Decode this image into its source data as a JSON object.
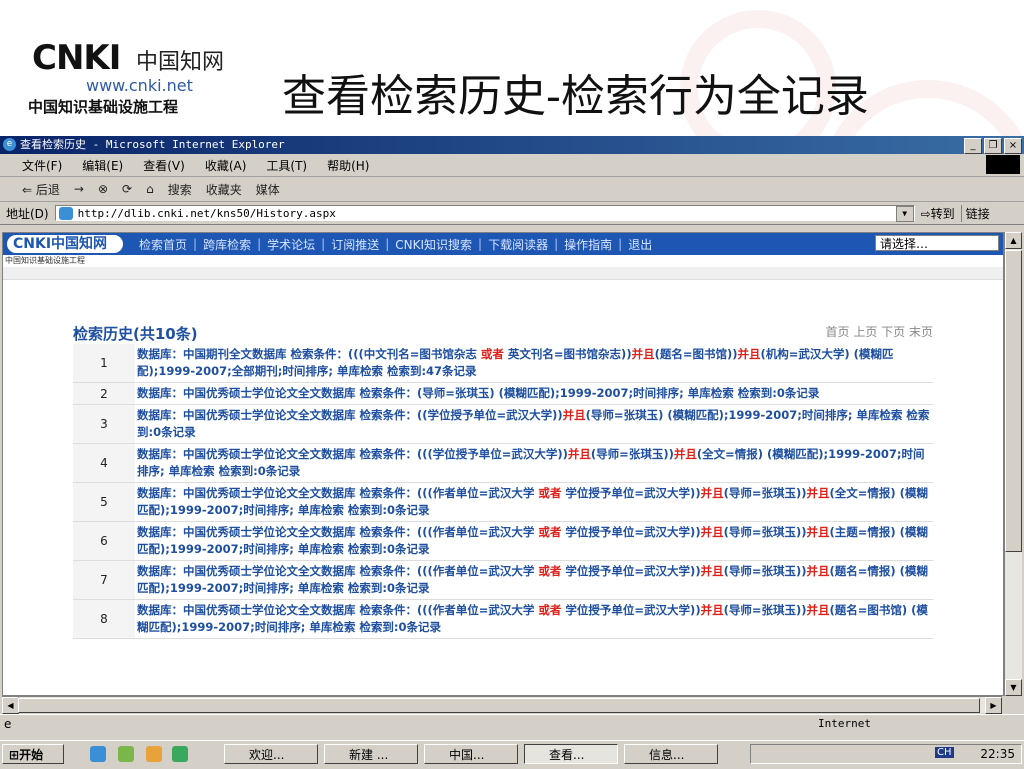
{
  "slide": {
    "logo_cnki": "CNKI",
    "logo_cn": "中国知网",
    "logo_url": "www.cnki.net",
    "logo_tagline": "中国知识基础设施工程",
    "title": "查看检索历史-检索行为全记录"
  },
  "window": {
    "title": "查看检索历史 - Microsoft Internet Explorer",
    "menu": [
      "文件(F)",
      "编辑(E)",
      "查看(V)",
      "收藏(A)",
      "工具(T)",
      "帮助(H)"
    ],
    "toolbar": [
      "⇐ 后退",
      "→",
      "⊗",
      "⟳",
      "⌂",
      "搜索",
      "收藏夹",
      "媒体"
    ],
    "address_label": "地址(D)",
    "address": "http://dlib.cnki.net/kns50/History.aspx",
    "go_label": "转到",
    "links_label": "链接",
    "status_zone": "Internet"
  },
  "site": {
    "logo": "CNKI中国知网",
    "subline": "中国知识基础设施工程",
    "nav": [
      "检索首页",
      "跨库检索",
      "学术论坛",
      "订阅推送",
      "CNKI知识搜索",
      "下载阅读器",
      "操作指南",
      "退出"
    ],
    "select": "请选择…"
  },
  "history": {
    "title": "检索历史(共10条)",
    "pager": "首页 上页 下页 末页",
    "rows": [
      {
        "num": "1",
        "parts": [
          [
            "数据库：中国期刊全文数据库  检索条件：(((中文刊名=图书馆杂志 ",
            0
          ],
          [
            "或者",
            1
          ],
          [
            " 英文刊名=图书馆杂志))",
            0
          ],
          [
            "并且",
            1
          ],
          [
            "(题名=图书馆))",
            0
          ],
          [
            "并且",
            1
          ],
          [
            "(机构=武汉大学) (模糊匹配);1999-2007;全部期刊;时间排序; 单库检索  检索到:47条记录",
            0
          ]
        ]
      },
      {
        "num": "2",
        "parts": [
          [
            "数据库：中国优秀硕士学位论文全文数据库  检索条件：(导师=张琪玉) (模糊匹配);1999-2007;时间排序; 单库检索  检索到:0条记录",
            0
          ]
        ]
      },
      {
        "num": "3",
        "parts": [
          [
            "数据库：中国优秀硕士学位论文全文数据库  检索条件：((学位授予单位=武汉大学))",
            0
          ],
          [
            "并且",
            1
          ],
          [
            "(导师=张琪玉) (模糊匹配);1999-2007;时间排序; 单库检索  检索到:0条记录",
            0
          ]
        ]
      },
      {
        "num": "4",
        "parts": [
          [
            "数据库：中国优秀硕士学位论文全文数据库  检索条件：(((学位授予单位=武汉大学))",
            0
          ],
          [
            "并且",
            1
          ],
          [
            "(导师=张琪玉))",
            0
          ],
          [
            "并且",
            1
          ],
          [
            "(全文=情报) (模糊匹配);1999-2007;时间排序; 单库检索  检索到:0条记录",
            0
          ]
        ]
      },
      {
        "num": "5",
        "parts": [
          [
            "数据库：中国优秀硕士学位论文全文数据库  检索条件：(((作者单位=武汉大学 ",
            0
          ],
          [
            "或者",
            1
          ],
          [
            " 学位授予单位=武汉大学))",
            0
          ],
          [
            "并且",
            1
          ],
          [
            "(导师=张琪玉))",
            0
          ],
          [
            "并且",
            1
          ],
          [
            "(全文=情报) (模糊匹配);1999-2007;时间排序; 单库检索  检索到:0条记录",
            0
          ]
        ]
      },
      {
        "num": "6",
        "parts": [
          [
            "数据库：中国优秀硕士学位论文全文数据库  检索条件：(((作者单位=武汉大学 ",
            0
          ],
          [
            "或者",
            1
          ],
          [
            " 学位授予单位=武汉大学))",
            0
          ],
          [
            "并且",
            1
          ],
          [
            "(导师=张琪玉))",
            0
          ],
          [
            "并且",
            1
          ],
          [
            "(主题=情报) (模糊匹配);1999-2007;时间排序; 单库检索  检索到:0条记录",
            0
          ]
        ]
      },
      {
        "num": "7",
        "parts": [
          [
            "数据库：中国优秀硕士学位论文全文数据库  检索条件：(((作者单位=武汉大学 ",
            0
          ],
          [
            "或者",
            1
          ],
          [
            " 学位授予单位=武汉大学))",
            0
          ],
          [
            "并且",
            1
          ],
          [
            "(导师=张琪玉))",
            0
          ],
          [
            "并且",
            1
          ],
          [
            "(题名=情报) (模糊匹配);1999-2007;时间排序; 单库检索  检索到:0条记录",
            0
          ]
        ]
      },
      {
        "num": "8",
        "parts": [
          [
            "数据库：中国优秀硕士学位论文全文数据库  检索条件：(((作者单位=武汉大学 ",
            0
          ],
          [
            "或者",
            1
          ],
          [
            " 学位授予单位=武汉大学))",
            0
          ],
          [
            "并且",
            1
          ],
          [
            "(导师=张琪玉))",
            0
          ],
          [
            "并且",
            1
          ],
          [
            "(题名=图书馆) (模糊匹配);1999-2007;时间排序; 单库检索  检索到:0条记录",
            0
          ]
        ]
      }
    ]
  },
  "taskbar": {
    "start": "开始",
    "tasks": [
      "欢迎...",
      "新建 ...",
      "中国...",
      "查看...",
      "信息..."
    ],
    "ime": "CH",
    "clock": "22:35"
  }
}
